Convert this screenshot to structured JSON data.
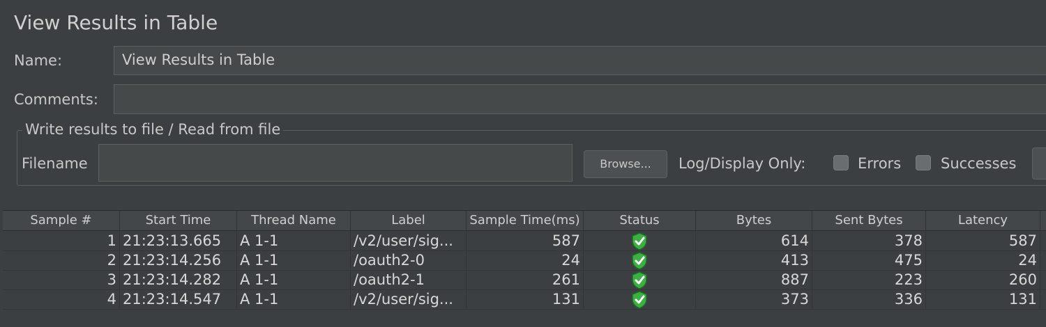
{
  "panel": {
    "title": "View Results in Table",
    "name_label": "Name:",
    "name_value": "View Results in Table",
    "comments_label": "Comments:",
    "comments_value": ""
  },
  "file_group": {
    "legend": "Write results to file / Read from file",
    "filename_label": "Filename",
    "filename_value": "",
    "browse_label": "Browse...",
    "log_display_label": "Log/Display Only:",
    "errors_label": "Errors",
    "errors_checked": false,
    "successes_label": "Successes",
    "successes_checked": false
  },
  "table": {
    "columns": [
      "Sample #",
      "Start Time",
      "Thread Name",
      "Label",
      "Sample Time(ms)",
      "Status",
      "Bytes",
      "Sent Bytes",
      "Latency"
    ],
    "rows": [
      {
        "sample": "1",
        "start": "21:23:13.665",
        "thread": "A 1-1",
        "label": "/v2/user/sig...",
        "time": "587",
        "status": "success-shield-icon",
        "bytes": "614",
        "sent": "378",
        "latency": "587"
      },
      {
        "sample": "2",
        "start": "21:23:14.256",
        "thread": "A 1-1",
        "label": "/oauth2-0",
        "time": "24",
        "status": "success-shield-icon",
        "bytes": "413",
        "sent": "475",
        "latency": "24"
      },
      {
        "sample": "3",
        "start": "21:23:14.282",
        "thread": "A 1-1",
        "label": "/oauth2-1",
        "time": "261",
        "status": "success-shield-icon",
        "bytes": "887",
        "sent": "223",
        "latency": "260"
      },
      {
        "sample": "4",
        "start": "21:23:14.547",
        "thread": "A 1-1",
        "label": "/v2/user/sig...",
        "time": "131",
        "status": "success-shield-icon",
        "bytes": "373",
        "sent": "336",
        "latency": "131"
      }
    ]
  },
  "colors": {
    "background": "#3c3f41",
    "status_success": "#3cb043"
  }
}
